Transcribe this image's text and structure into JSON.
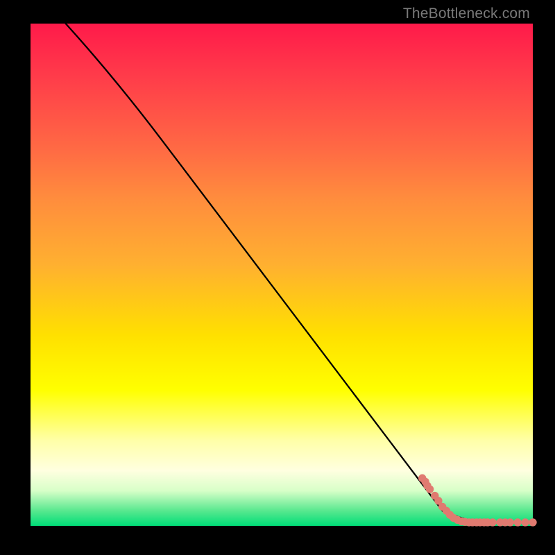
{
  "credit_text": "TheBottleneck.com",
  "chart_data": {
    "type": "line",
    "title": "",
    "xlabel": "",
    "ylabel": "",
    "xlim": [
      0,
      100
    ],
    "ylim": [
      0,
      100
    ],
    "curve": [
      {
        "x": 7,
        "y": 100
      },
      {
        "x": 26,
        "y": 77
      },
      {
        "x": 82,
        "y": 3
      },
      {
        "x": 90,
        "y": 0.7
      },
      {
        "x": 100,
        "y": 0.7
      }
    ],
    "points": [
      {
        "x": 78.0,
        "y": 9.5
      },
      {
        "x": 78.6,
        "y": 8.8
      },
      {
        "x": 79.0,
        "y": 8.0
      },
      {
        "x": 79.5,
        "y": 7.3
      },
      {
        "x": 80.5,
        "y": 6.0
      },
      {
        "x": 81.2,
        "y": 5.0
      },
      {
        "x": 82.0,
        "y": 3.8
      },
      {
        "x": 82.8,
        "y": 3.0
      },
      {
        "x": 83.5,
        "y": 2.2
      },
      {
        "x": 84.2,
        "y": 1.6
      },
      {
        "x": 85.0,
        "y": 1.2
      },
      {
        "x": 85.8,
        "y": 0.9
      },
      {
        "x": 86.5,
        "y": 0.8
      },
      {
        "x": 87.3,
        "y": 0.7
      },
      {
        "x": 88.0,
        "y": 0.7
      },
      {
        "x": 88.8,
        "y": 0.7
      },
      {
        "x": 89.5,
        "y": 0.7
      },
      {
        "x": 90.3,
        "y": 0.7
      },
      {
        "x": 91.0,
        "y": 0.7
      },
      {
        "x": 92.0,
        "y": 0.7
      },
      {
        "x": 93.5,
        "y": 0.7
      },
      {
        "x": 94.5,
        "y": 0.7
      },
      {
        "x": 95.5,
        "y": 0.7
      },
      {
        "x": 97.0,
        "y": 0.7
      },
      {
        "x": 98.5,
        "y": 0.7
      },
      {
        "x": 100.0,
        "y": 0.7
      }
    ],
    "dot_radius": 5.2
  }
}
